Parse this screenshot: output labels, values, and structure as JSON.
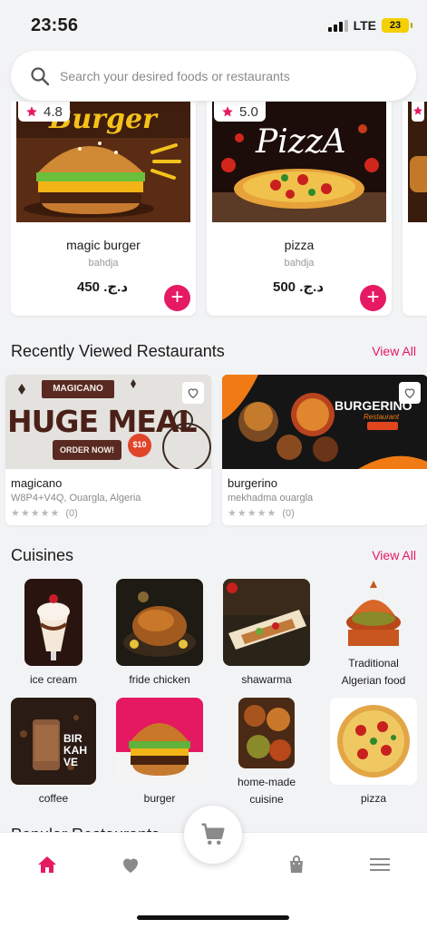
{
  "status_bar": {
    "time": "23:56",
    "network": "LTE",
    "battery": "23"
  },
  "search": {
    "placeholder": "Search your desired foods or restaurants",
    "icon": "search-icon"
  },
  "products": [
    {
      "name": "magic burger",
      "category": "bahdja",
      "price": "450 .د.ج",
      "rating": "4.8",
      "image_text": "Burger"
    },
    {
      "name": "pizza",
      "category": "bahdja",
      "price": "500 .د.ج",
      "rating": "5.0",
      "image_text": "PizzA"
    }
  ],
  "recently_viewed": {
    "title": "Recently Viewed Restaurants",
    "view_all": "View All",
    "restaurants": [
      {
        "name": "magicano",
        "address": "W8P4+V4Q, Ouargla, Algeria",
        "rating_count": "(0)",
        "banner_title": "MAGICANO",
        "banner_headline": "HUGE MEAL",
        "banner_button": "ORDER NOW!",
        "banner_badge": "$10"
      },
      {
        "name": "burgerino",
        "address": "mekhadma ouargla",
        "rating_count": "(0)",
        "banner_title": "BURGERINO",
        "banner_subtitle": "Restaurant"
      }
    ]
  },
  "cuisines": {
    "title": "Cuisines",
    "view_all": "View All",
    "items": [
      {
        "label": "ice cream"
      },
      {
        "label": "fride chicken"
      },
      {
        "label": "shawarma"
      },
      {
        "label": "Traditional\nAlgerian food"
      },
      {
        "label": "coffee",
        "image_text": "BIR KAH VE"
      },
      {
        "label": "burger"
      },
      {
        "label": "home-made\ncuisine"
      },
      {
        "label": "pizza"
      }
    ]
  },
  "partial_section_title": "Popular Restaurants",
  "colors": {
    "accent": "#e51a63",
    "background": "#f2f3f5",
    "star": "#bbbbbb"
  },
  "bottom_nav": {
    "items": [
      "home-icon",
      "heart-icon",
      "cart-icon",
      "bag-icon",
      "menu-icon"
    ],
    "active": "home-icon"
  }
}
